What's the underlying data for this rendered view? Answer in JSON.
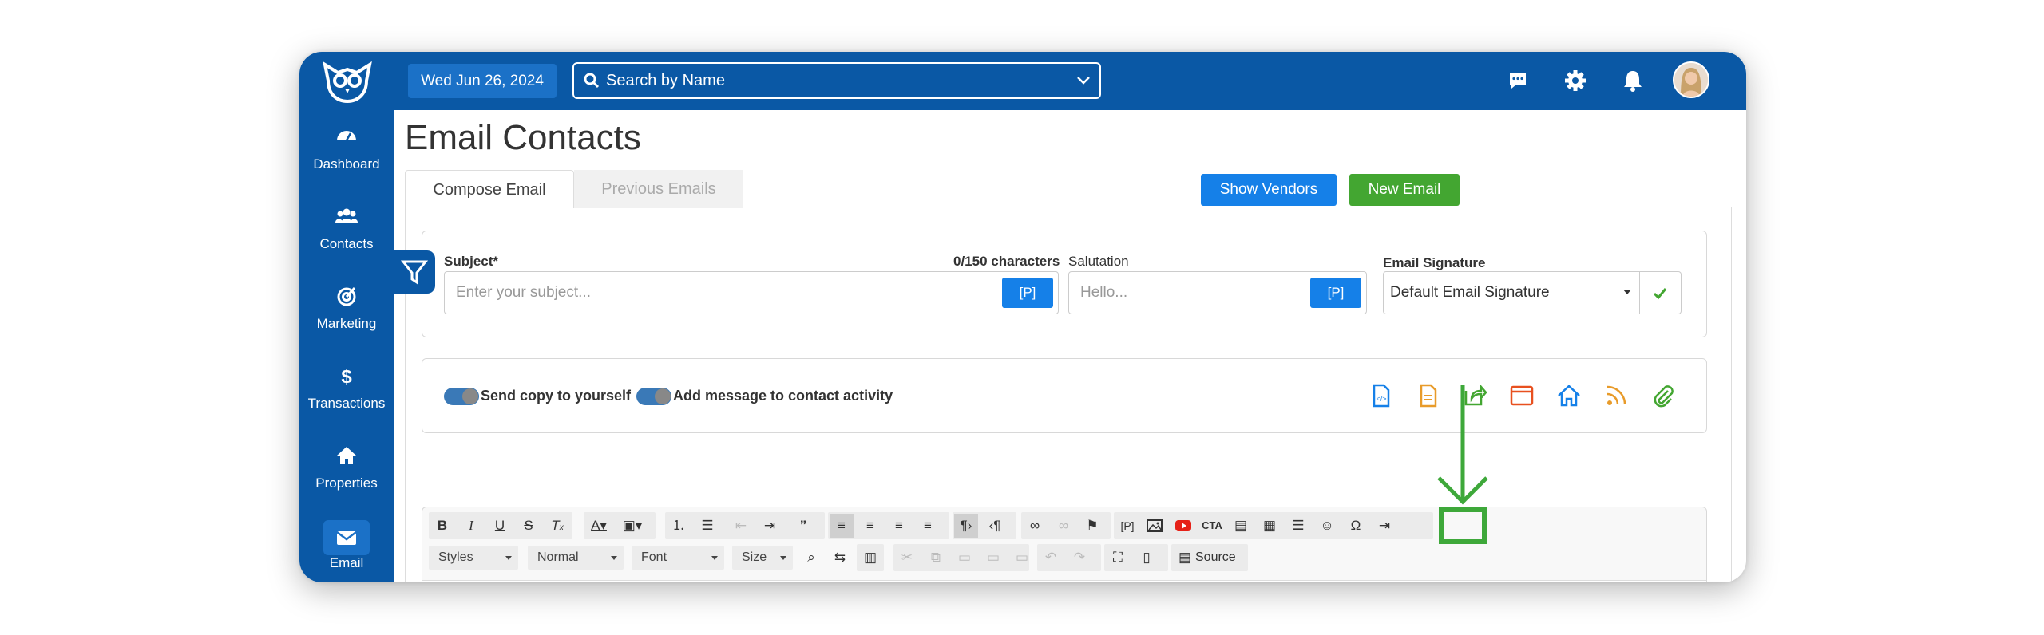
{
  "header": {
    "date": "Wed Jun 26, 2024",
    "search_placeholder": "Search by Name"
  },
  "sidebar": {
    "items": [
      {
        "label": "Dashboard",
        "icon": "dashboard-icon"
      },
      {
        "label": "Contacts",
        "icon": "contacts-icon"
      },
      {
        "label": "Marketing",
        "icon": "marketing-icon"
      },
      {
        "label": "Transactions",
        "icon": "dollar-icon"
      },
      {
        "label": "Properties",
        "icon": "home-icon"
      },
      {
        "label": "Email",
        "icon": "envelope-icon",
        "active": true
      }
    ]
  },
  "page": {
    "title": "Email Contacts",
    "tabs": [
      "Compose Email",
      "Previous Emails"
    ],
    "show_vendors": "Show Vendors",
    "new_email": "New Email"
  },
  "form": {
    "subject_label": "Subject*",
    "subject_count": "0/150 characters",
    "subject_placeholder": "Enter your subject...",
    "p_button": "[P]",
    "salutation_label": "Salutation",
    "salutation_placeholder": "Hello...",
    "signature_label": "Email Signature",
    "signature_value": "Default Email Signature"
  },
  "options": {
    "send_copy": "Send copy to yourself",
    "add_activity": "Add message to contact activity"
  },
  "editor": {
    "styles": "Styles",
    "format": "Normal",
    "font": "Font",
    "size": "Size",
    "source": "Source"
  },
  "colors": {
    "brand": "#0a58a5",
    "accent_blue": "#1580e8",
    "green": "#43a631",
    "highlight": "#3ea83a"
  }
}
